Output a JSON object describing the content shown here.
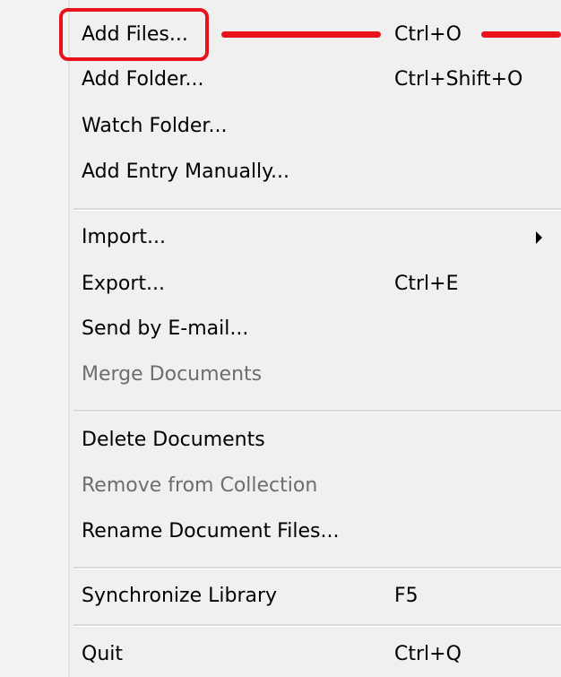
{
  "menu": {
    "items": [
      {
        "label": "Add Files...",
        "shortcut": "Ctrl+O",
        "enabled": true,
        "highlighted": true
      },
      {
        "label": "Add Folder...",
        "shortcut": "Ctrl+Shift+O",
        "enabled": true
      },
      {
        "label": "Watch Folder...",
        "shortcut": "",
        "enabled": true
      },
      {
        "label": "Add Entry Manually...",
        "shortcut": "",
        "enabled": true
      },
      {
        "label": "Import...",
        "shortcut": "",
        "enabled": true,
        "submenu": true
      },
      {
        "label": "Export...",
        "shortcut": "Ctrl+E",
        "enabled": true
      },
      {
        "label": "Send by E-mail...",
        "shortcut": "",
        "enabled": true
      },
      {
        "label": "Merge Documents",
        "shortcut": "",
        "enabled": false
      },
      {
        "label": "Delete Documents",
        "shortcut": "",
        "enabled": true
      },
      {
        "label": "Remove from Collection",
        "shortcut": "",
        "enabled": false
      },
      {
        "label": "Rename Document Files...",
        "shortcut": "",
        "enabled": true
      },
      {
        "label": "Synchronize Library",
        "shortcut": "F5",
        "enabled": true
      },
      {
        "label": "Quit",
        "shortcut": "Ctrl+Q",
        "enabled": true
      }
    ]
  },
  "colors": {
    "annotation": "#e8121b",
    "disabled_text": "#6d6d6d",
    "menu_background": "#f0f0f0"
  }
}
